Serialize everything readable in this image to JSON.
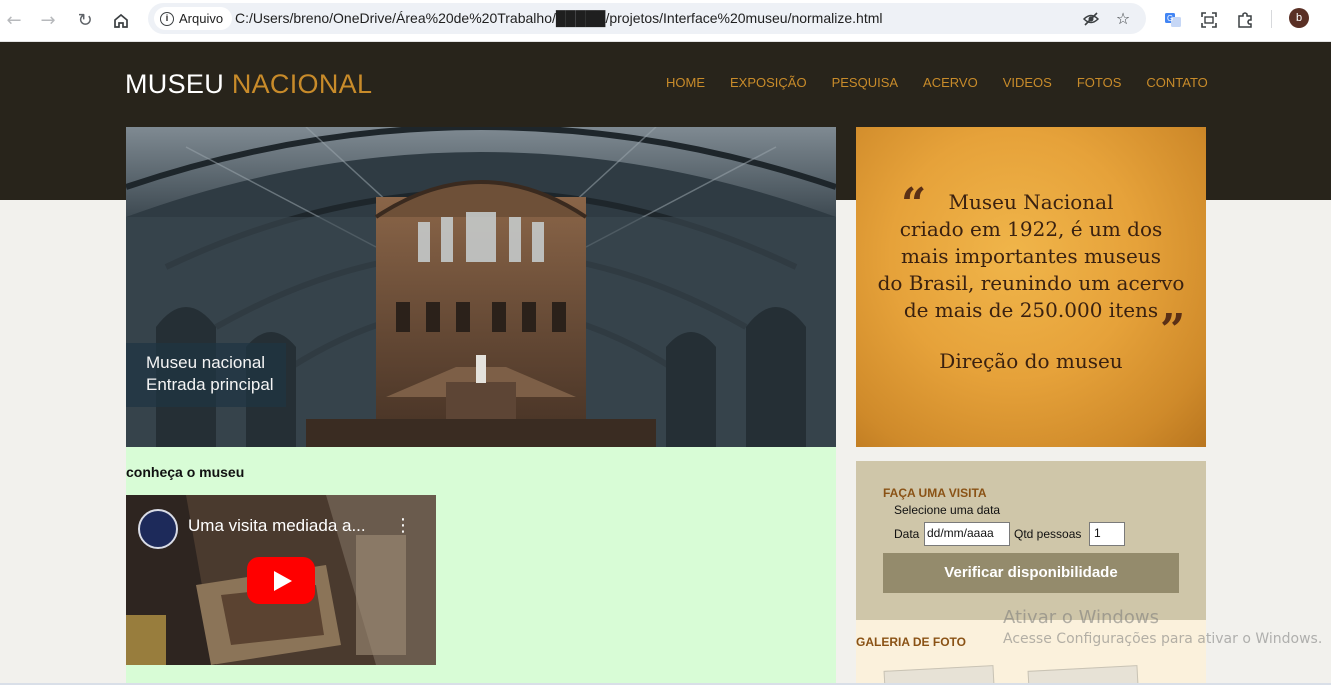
{
  "browser": {
    "chip_label": "Arquivo",
    "url": "C:/Users/breno/OneDrive/Área%20de%20Trabalho/█████/projetos/Interface%20museu/normalize.html",
    "avatar_letter": "b"
  },
  "site": {
    "logo": {
      "part1": "MUSEU",
      "part2": "NACIONAL"
    },
    "menu": [
      "HOME",
      "EXPOSIÇÃO",
      "PESQUISA",
      "ACERVO",
      "VIDEOS",
      "FOTOS",
      "CONTATO"
    ],
    "accent_color": "#c88b2a",
    "hero": {
      "caption_line1": "Museu nacional",
      "caption_line2": "Entrada principal"
    },
    "section_title": "conheça o museu",
    "video": {
      "title": "Uma visita mediada a..."
    },
    "quote": {
      "lines": [
        "Museu Nacional",
        "criado em 1922, é um dos",
        "mais importantes museus",
        "do Brasil, reunindo um acervo",
        "de mais de 250.000 itens"
      ],
      "author": "Direção do museu"
    },
    "visit": {
      "title": "FAÇA UMA VISITA",
      "select_label": "Selecione uma data",
      "date_label": "Data",
      "date_placeholder": "dd/mm/aaaa",
      "qty_label": "Qtd pessoas",
      "qty_value": "1",
      "button_label": "Verificar disponibilidade"
    },
    "gallery_title": "GALERIA DE FOTO"
  },
  "watermark": {
    "title": "Ativar o Windows",
    "subtitle": "Acesse Configurações para ativar o Windows."
  }
}
